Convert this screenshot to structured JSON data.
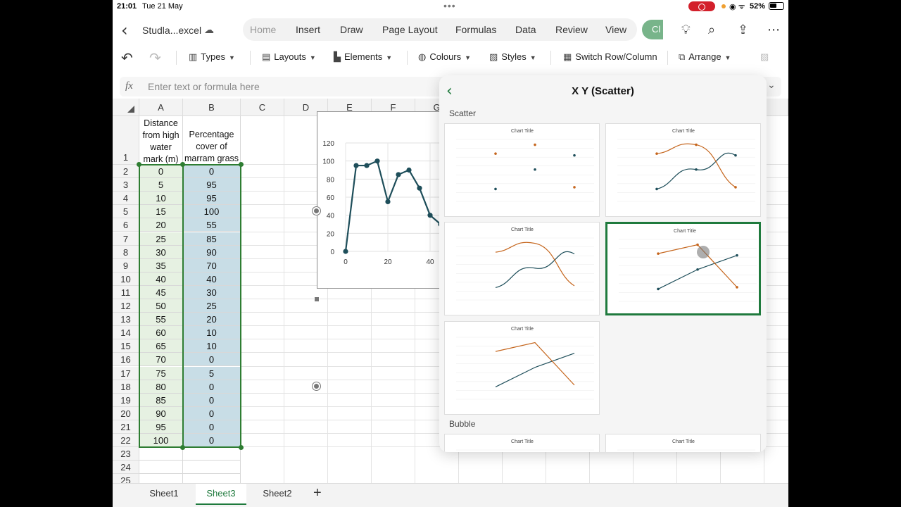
{
  "status": {
    "time": "21:01",
    "date": "Tue 21 May",
    "battery": "52%"
  },
  "doc": {
    "title": "Studla...excel"
  },
  "tabs": [
    "Home",
    "Insert",
    "Draw",
    "Page Layout",
    "Formulas",
    "Data",
    "Review",
    "View"
  ],
  "active_tab": "Home",
  "copilot_label": "Cl",
  "ribbon": {
    "types": "Types",
    "layouts": "Layouts",
    "elements": "Elements",
    "colours": "Colours",
    "styles": "Styles",
    "switch": "Switch Row/Column",
    "arrange": "Arrange"
  },
  "formula": {
    "placeholder": "Enter text or formula here"
  },
  "columns": [
    "A",
    "B",
    "C",
    "D",
    "E",
    "F",
    "G"
  ],
  "header_row": {
    "a": "Distance from high water mark (m)",
    "b": "Percentage cover of marram grass"
  },
  "rows": [
    {
      "r": "2",
      "a": "0",
      "b": "0"
    },
    {
      "r": "3",
      "a": "5",
      "b": "95"
    },
    {
      "r": "4",
      "a": "10",
      "b": "95"
    },
    {
      "r": "5",
      "a": "15",
      "b": "100"
    },
    {
      "r": "6",
      "a": "20",
      "b": "55"
    },
    {
      "r": "7",
      "a": "25",
      "b": "85"
    },
    {
      "r": "8",
      "a": "30",
      "b": "90"
    },
    {
      "r": "9",
      "a": "35",
      "b": "70"
    },
    {
      "r": "10",
      "a": "40",
      "b": "40"
    },
    {
      "r": "11",
      "a": "45",
      "b": "30"
    },
    {
      "r": "12",
      "a": "50",
      "b": "25"
    },
    {
      "r": "13",
      "a": "55",
      "b": "20"
    },
    {
      "r": "14",
      "a": "60",
      "b": "10"
    },
    {
      "r": "15",
      "a": "65",
      "b": "10"
    },
    {
      "r": "16",
      "a": "70",
      "b": "0"
    },
    {
      "r": "17",
      "a": "75",
      "b": "5"
    },
    {
      "r": "18",
      "a": "80",
      "b": "0"
    },
    {
      "r": "19",
      "a": "85",
      "b": "0"
    },
    {
      "r": "20",
      "a": "90",
      "b": "0"
    },
    {
      "r": "21",
      "a": "95",
      "b": "0"
    },
    {
      "r": "22",
      "a": "100",
      "b": "0"
    }
  ],
  "extra_rows": [
    "23",
    "24",
    "25"
  ],
  "sheets": [
    "Sheet1",
    "Sheet3",
    "Sheet2"
  ],
  "active_sheet": "Sheet3",
  "panel": {
    "title": "X Y (Scatter)",
    "section_scatter": "Scatter",
    "section_bubble": "Bubble",
    "thumb_title": "Chart Title"
  },
  "chart_data": {
    "type": "scatter",
    "x": [
      0,
      5,
      10,
      15,
      20,
      25,
      30,
      35,
      40,
      45,
      50,
      55,
      60,
      65,
      70,
      75,
      80,
      85,
      90,
      95,
      100
    ],
    "y": [
      0,
      95,
      95,
      100,
      55,
      85,
      90,
      70,
      40,
      30,
      25,
      20,
      10,
      10,
      0,
      5,
      0,
      0,
      0,
      0,
      0
    ],
    "xticks": [
      "0",
      "20",
      "40"
    ],
    "yticks": [
      "0",
      "20",
      "40",
      "60",
      "80",
      "100",
      "120"
    ],
    "ylim": [
      0,
      120
    ],
    "series_color": "#1e4e5a"
  }
}
